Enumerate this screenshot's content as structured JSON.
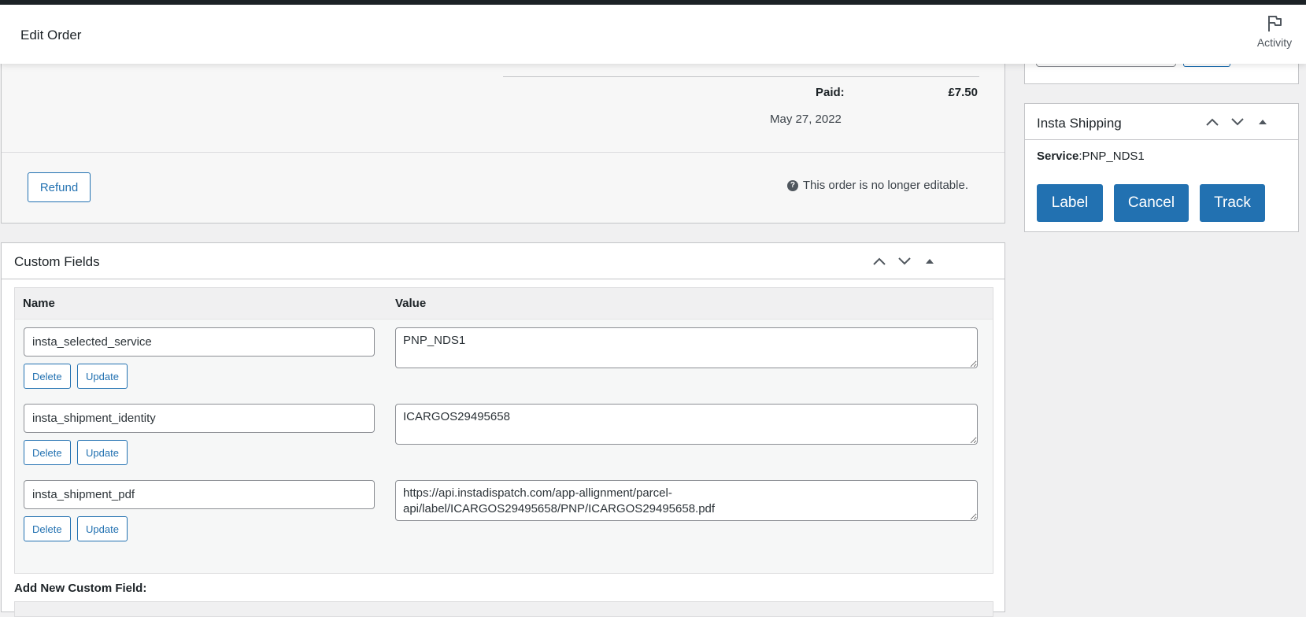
{
  "header": {
    "title": "Edit Order",
    "activity_label": "Activity"
  },
  "order_totals": {
    "paid_label": "Paid:",
    "paid_amount": "£7.50",
    "paid_date": "May 27, 2022",
    "refund_label": "Refund",
    "not_editable_note": "This order is no longer editable."
  },
  "custom_fields": {
    "title": "Custom Fields",
    "col_name": "Name",
    "col_value": "Value",
    "delete_label": "Delete",
    "update_label": "Update",
    "rows": [
      {
        "name": "insta_selected_service",
        "value": "PNP_NDS1"
      },
      {
        "name": "insta_shipment_identity",
        "value": "ICARGOS29495658"
      },
      {
        "name": "insta_shipment_pdf",
        "value": "https://api.instadispatch.com/app-allignment/parcel-api/label/ICARGOS29495658/PNP/ICARGOS29495658.pdf"
      }
    ],
    "add_new_label": "Add New Custom Field:"
  },
  "insta_shipping": {
    "title": "Insta Shipping",
    "service_label": "Service",
    "service_value": ":PNP_NDS1",
    "label_btn": "Label",
    "cancel_btn": "Cancel",
    "track_btn": "Track"
  },
  "colors": {
    "primary": "#2271b1",
    "text": "#1d2327",
    "border": "#c3c4c7"
  }
}
